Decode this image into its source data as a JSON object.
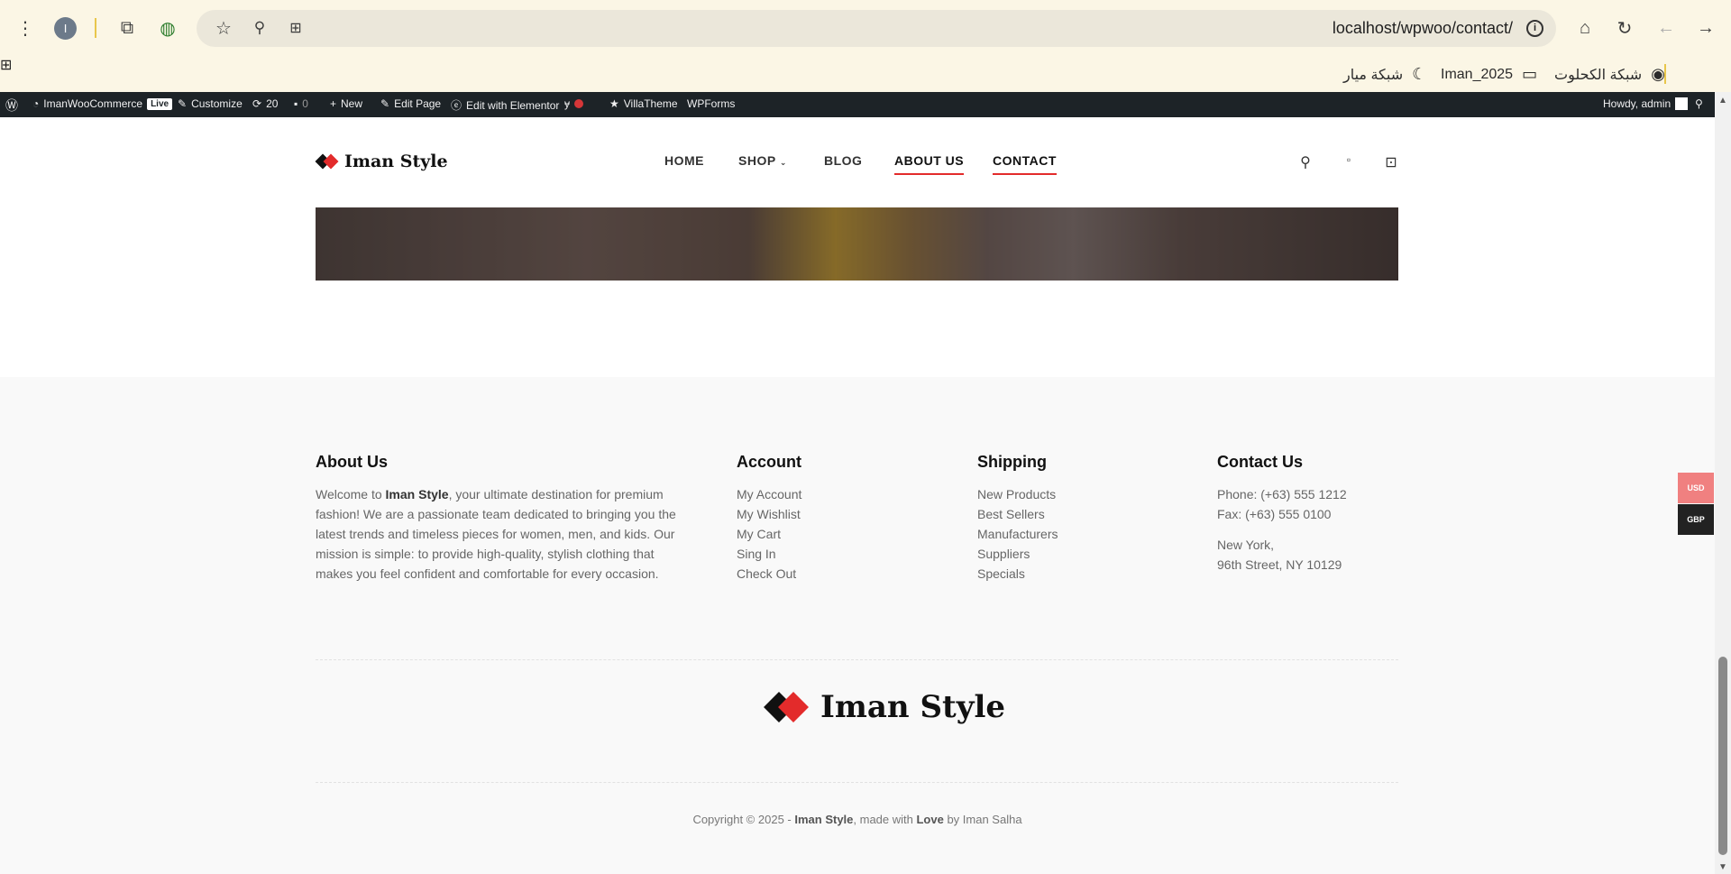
{
  "browser": {
    "url": "localhost/wpwoo/contact/",
    "profile_initial": "I",
    "bookmarks": [
      "شبكة الكحلوت",
      "Iman_2025",
      "شبكة ميار"
    ]
  },
  "adminbar": {
    "site": "ImanWooCommerce",
    "live": "Live",
    "customize": "Customize",
    "updates": "20",
    "comments": "0",
    "new": "New",
    "edit_page": "Edit Page",
    "elementor": "Edit with Elementor",
    "villatheme": "VillaTheme",
    "wpforms": "WPForms",
    "howdy": "Howdy, admin"
  },
  "site": {
    "logo_text": "Iman Style",
    "nav": {
      "home": "HOME",
      "shop": "SHOP",
      "blog": "BLOG",
      "about": "ABOUT US",
      "contact": "CONTACT"
    }
  },
  "footer": {
    "about": {
      "title": "About Us",
      "pre": "Welcome to ",
      "brand": "Iman Style",
      "body": ", your ultimate destination for premium fashion! We are a passionate team dedicated to bringing you the latest trends and timeless pieces for women, men, and kids. Our mission is simple: to provide high-quality, stylish clothing that makes you feel confident and comfortable for every occasion."
    },
    "account": {
      "title": "Account",
      "items": [
        "My Account",
        "My Wishlist",
        "My Cart",
        "Sing In",
        "Check Out"
      ]
    },
    "shipping": {
      "title": "Shipping",
      "items": [
        "New Products",
        "Best Sellers",
        "Manufacturers",
        "Suppliers",
        "Specials"
      ]
    },
    "contact": {
      "title": "Contact Us",
      "phone": "Phone: (+63) 555 1212",
      "fax": "Fax: (+63) 555 0100",
      "city": "New York,",
      "street": "96th Street, NY 10129"
    },
    "copyright": {
      "pre": "Copyright © 2025 - ",
      "brand": "Iman Style",
      "mid": ", made with ",
      "love": "Love",
      "post": " by Iman Salha"
    }
  },
  "currency": {
    "usd": "USD",
    "gbp": "GBP",
    "usd_color": "#f08080",
    "gbp_color": "#222222"
  }
}
